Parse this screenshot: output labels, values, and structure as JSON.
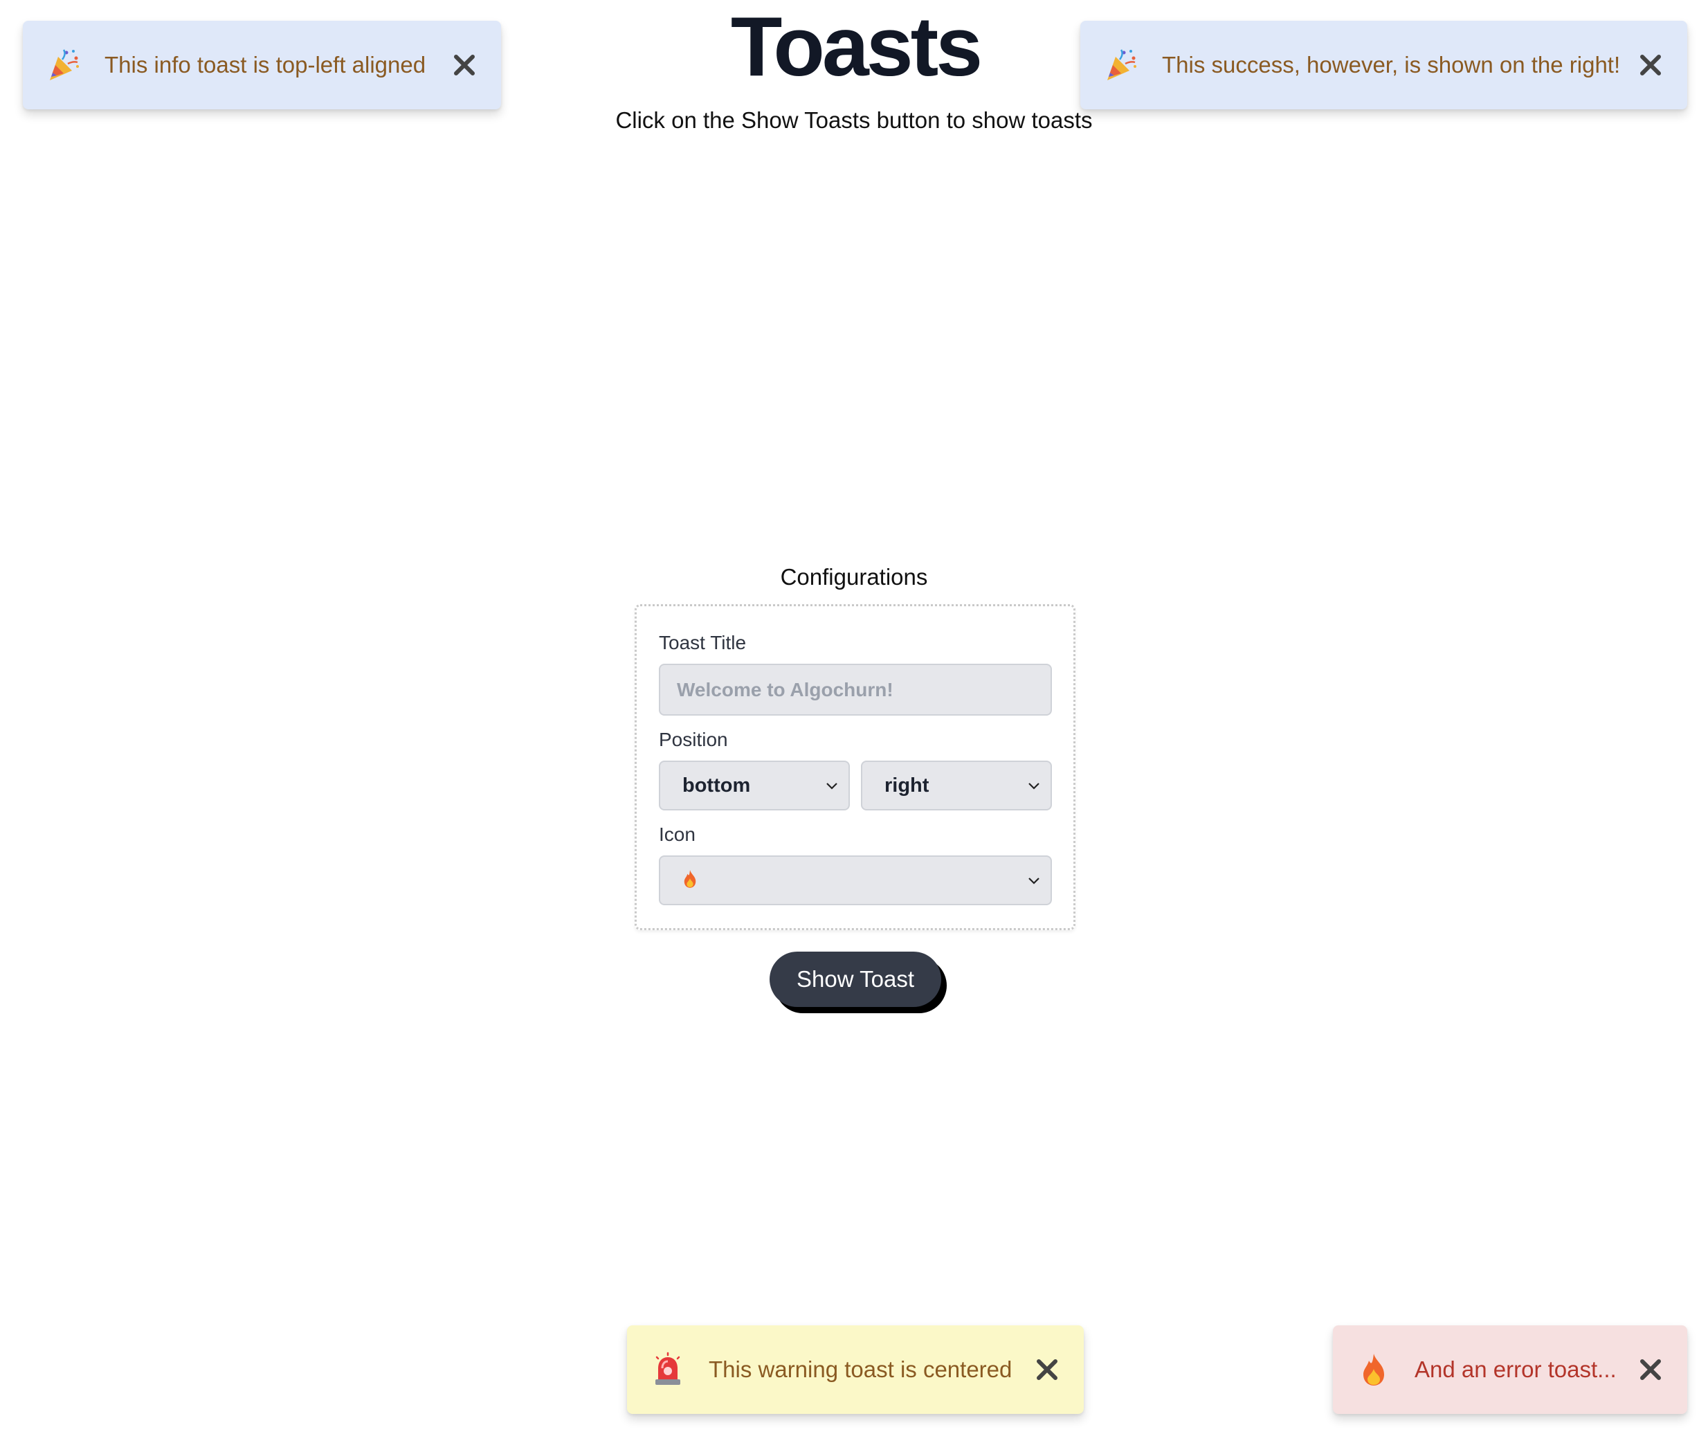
{
  "header": {
    "title": "Toasts",
    "subtitle": "Click on the Show Toasts button to show toasts"
  },
  "toasts": [
    {
      "type": "info",
      "icon": "party-popper-icon",
      "text": "This info toast is top-left aligned",
      "close_icon": "close-icon"
    },
    {
      "type": "success",
      "icon": "party-popper-icon",
      "text": "This success, however, is shown on the right!",
      "close_icon": "close-icon"
    },
    {
      "type": "warning",
      "icon": "siren-icon",
      "text": "This warning toast is centered",
      "close_icon": "close-icon"
    },
    {
      "type": "error",
      "icon": "fire-icon",
      "text": "And an error toast...",
      "close_icon": "close-icon"
    }
  ],
  "config": {
    "heading": "Configurations",
    "title_label": "Toast Title",
    "title_placeholder": "Welcome to Algochurn!",
    "position_label": "Position",
    "position_vertical": "bottom",
    "position_horizontal": "right",
    "icon_label": "Icon",
    "icon_value": "🔥"
  },
  "button": {
    "show_label": "Show Toast"
  },
  "colors": {
    "info_bg": "#dfe8f9",
    "warning_bg": "#fbf8c8",
    "error_bg": "#f6e0e0",
    "toast_text": "#8a5a22",
    "error_text": "#b3352a",
    "button_bg": "#353b48"
  }
}
